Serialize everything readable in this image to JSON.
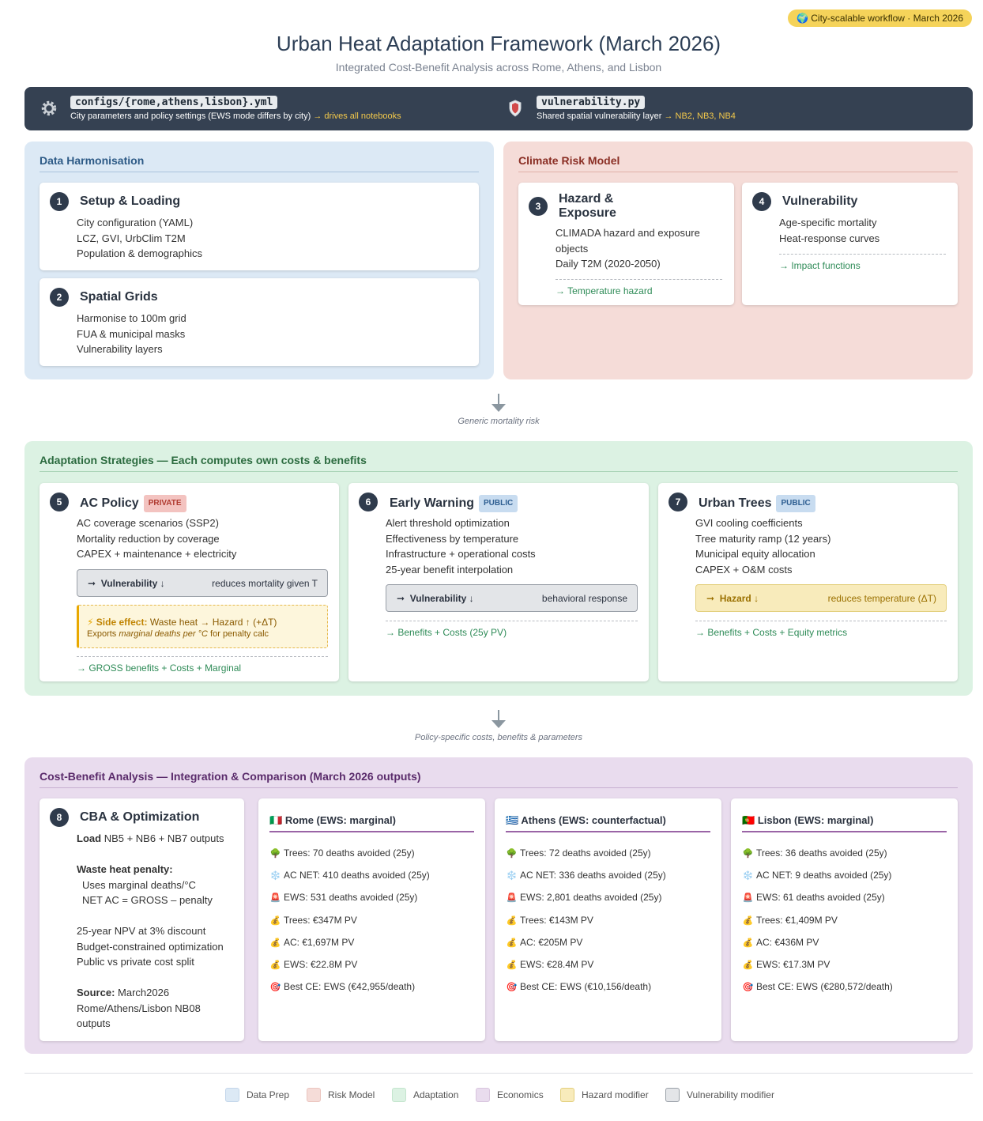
{
  "header": {
    "badge": "🌍 City-scalable workflow · March 2026",
    "title": "Urban Heat Adaptation Framework (March 2026)",
    "subtitle": "Integrated Cost-Benefit Analysis across Rome, Athens, and Lisbon"
  },
  "config_bar": {
    "left": {
      "icon": "gear-icon",
      "code": "configs/{rome,athens,lisbon}.yml",
      "desc": "City parameters and policy settings (EWS mode differs by city)",
      "highlight": "→ drives all notebooks"
    },
    "right": {
      "icon": "shield-icon",
      "code": "vulnerability.py",
      "desc": "Shared spatial vulnerability layer",
      "highlight": "→ NB2, NB3, NB4"
    }
  },
  "data_harmonisation": {
    "title": "Data Harmonisation",
    "cards": [
      {
        "num": "1",
        "title": "Setup & Loading",
        "lines": [
          "City configuration (YAML)",
          "LCZ, GVI, UrbClim T2M",
          "Population & demographics"
        ]
      },
      {
        "num": "2",
        "title": "Spatial Grids",
        "lines": [
          "Harmonise to 100m grid",
          "FUA & municipal masks",
          "Vulnerability layers"
        ]
      }
    ]
  },
  "climate_risk": {
    "title": "Climate Risk Model",
    "cards": [
      {
        "num": "3",
        "title_1": "Hazard &",
        "title_2": "Exposure",
        "lines": [
          "CLIMADA hazard and exposure",
          "objects",
          "Daily T2M (2020-2050)"
        ],
        "output": "→ Temperature hazard"
      },
      {
        "num": "4",
        "title": "Vulnerability",
        "lines": [
          "Age-specific mortality",
          "Heat-response curves"
        ],
        "output": "→ Impact functions"
      }
    ]
  },
  "arrow_1_label": "Generic mortality risk",
  "adaptation": {
    "title": "Adaptation Strategies — Each computes own costs & benefits",
    "cards": [
      {
        "num": "5",
        "title": "AC Policy",
        "tag": "PRIVATE",
        "lines": [
          "AC coverage scenarios (SSP2)",
          "Mortality reduction by coverage",
          "CAPEX + maintenance + electricity"
        ],
        "modifier_label": "Vulnerability ↓",
        "modifier_desc": "reduces mortality given T",
        "side_effect": {
          "icon": "⚡",
          "label": "Side effect:",
          "text": "Waste heat → Hazard ↑ (+ΔT)",
          "line2_a": "Exports",
          "line2_em": "marginal deaths per °C",
          "line2_b": "for penalty calc"
        },
        "output": "→ GROSS benefits + Costs + Marginal"
      },
      {
        "num": "6",
        "title": "Early Warning",
        "tag": "PUBLIC",
        "lines": [
          "Alert threshold optimization",
          "Effectiveness by temperature",
          "Infrastructure + operational costs",
          "25-year benefit interpolation"
        ],
        "modifier_label": "Vulnerability ↓",
        "modifier_desc": "behavioral response",
        "output": "→ Benefits + Costs (25y PV)"
      },
      {
        "num": "7",
        "title": "Urban Trees",
        "tag": "PUBLIC",
        "lines": [
          "GVI cooling coefficients",
          "Tree maturity ramp (12 years)",
          "Municipal equity allocation",
          "CAPEX + O&M costs"
        ],
        "modifier_label": "Hazard ↓",
        "modifier_desc": "reduces temperature (ΔT)",
        "output": "→ Benefits + Costs + Equity metrics"
      }
    ]
  },
  "arrow_2_label": "Policy-specific costs, benefits & parameters",
  "cba": {
    "title": "Cost-Benefit Analysis — Integration & Comparison (March 2026 outputs)",
    "card": {
      "num": "8",
      "title": "CBA & Optimization",
      "load_bold": "Load",
      "load_text": "NB5 + NB6 + NB7 outputs",
      "penalty_title": "Waste heat penalty:",
      "penalty_1": "Uses marginal deaths/°C",
      "penalty_2": "NET AC = GROSS – penalty",
      "lines": [
        "25-year NPV at 3% discount",
        "Budget-constrained optimization",
        "Public vs private cost split"
      ],
      "source_bold": "Source:",
      "source_1": "March2026",
      "source_2": "Rome/Athens/Lisbon NB08",
      "source_3": "outputs"
    },
    "cities": [
      {
        "flag": "🇮🇹",
        "name": "Rome (EWS: marginal)",
        "items": [
          {
            "icon": "🌳",
            "text": "Trees: 70 deaths avoided (25y)"
          },
          {
            "icon": "❄️",
            "text": "AC NET: 410 deaths avoided (25y)"
          },
          {
            "icon": "🚨",
            "text": "EWS: 531 deaths avoided (25y)"
          },
          {
            "icon": "💰",
            "text": "Trees: €347M PV"
          },
          {
            "icon": "💰",
            "text": "AC: €1,697M PV"
          },
          {
            "icon": "💰",
            "text": "EWS: €22.8M PV"
          },
          {
            "icon": "🎯",
            "text": "Best CE: EWS (€42,955/death)"
          }
        ]
      },
      {
        "flag": "🇬🇷",
        "name": "Athens (EWS: counterfactual)",
        "items": [
          {
            "icon": "🌳",
            "text": "Trees: 72 deaths avoided (25y)"
          },
          {
            "icon": "❄️",
            "text": "AC NET: 336 deaths avoided (25y)"
          },
          {
            "icon": "🚨",
            "text": "EWS: 2,801 deaths avoided (25y)"
          },
          {
            "icon": "💰",
            "text": "Trees: €143M PV"
          },
          {
            "icon": "💰",
            "text": "AC: €205M PV"
          },
          {
            "icon": "💰",
            "text": "EWS: €28.4M PV"
          },
          {
            "icon": "🎯",
            "text": "Best CE: EWS (€10,156/death)"
          }
        ]
      },
      {
        "flag": "🇵🇹",
        "name": "Lisbon (EWS: marginal)",
        "items": [
          {
            "icon": "🌳",
            "text": "Trees: 36 deaths avoided (25y)"
          },
          {
            "icon": "❄️",
            "text": "AC NET: 9 deaths avoided (25y)"
          },
          {
            "icon": "🚨",
            "text": "EWS: 61 deaths avoided (25y)"
          },
          {
            "icon": "💰",
            "text": "Trees: €1,409M PV"
          },
          {
            "icon": "💰",
            "text": "AC: €436M PV"
          },
          {
            "icon": "💰",
            "text": "EWS: €17.3M PV"
          },
          {
            "icon": "🎯",
            "text": "Best CE: EWS (€280,572/death)"
          }
        ]
      }
    ]
  },
  "legend": [
    {
      "label": "Data Prep",
      "color": "#dce9f5"
    },
    {
      "label": "Risk Model",
      "color": "#f5dcd8"
    },
    {
      "label": "Adaptation",
      "color": "#dcf2e3"
    },
    {
      "label": "Economics",
      "color": "#e9dcee"
    },
    {
      "label": "Hazard modifier",
      "color": "#f8ebbb"
    },
    {
      "label": "Vulnerability modifier",
      "color": "#e3e5e8"
    }
  ],
  "colors": {
    "data_prep": "#dce9f5",
    "risk_model": "#f5dcd8",
    "adaptation": "#dcf2e3",
    "economics": "#e9dcee",
    "hazard_modifier": "#f8ebbb",
    "vulnerability_modifier": "#e3e5e8",
    "config_bar": "#354152",
    "badge": "#f5d35a"
  }
}
